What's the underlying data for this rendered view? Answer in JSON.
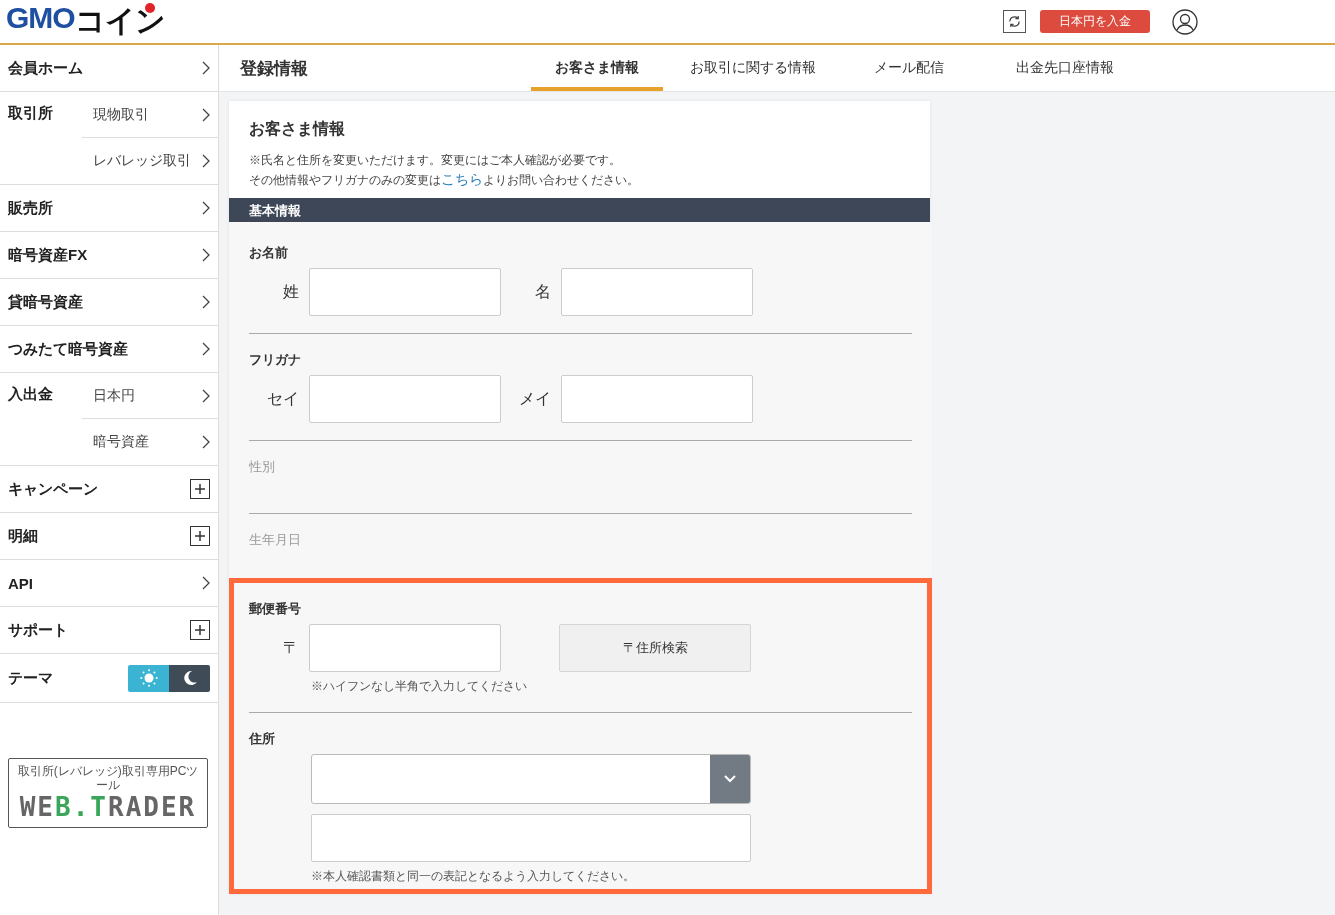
{
  "header": {
    "logo": {
      "primary": "GMO",
      "secondary": "コイン"
    },
    "deposit_button": "日本円を入金"
  },
  "sidebar": {
    "items": [
      {
        "kind": "link",
        "label": "会員ホーム"
      },
      {
        "kind": "group",
        "label": "取引所",
        "children": [
          {
            "label": "現物取引"
          },
          {
            "label": "レバレッジ取引"
          }
        ]
      },
      {
        "kind": "link",
        "label": "販売所"
      },
      {
        "kind": "link",
        "label": "暗号資産FX"
      },
      {
        "kind": "link",
        "label": "貸暗号資産"
      },
      {
        "kind": "link",
        "label": "つみたて暗号資産"
      },
      {
        "kind": "group",
        "label": "入出金",
        "children": [
          {
            "label": "日本円"
          },
          {
            "label": "暗号資産"
          }
        ]
      },
      {
        "kind": "expand",
        "label": "キャンペーン"
      },
      {
        "kind": "expand",
        "label": "明細"
      },
      {
        "kind": "link",
        "label": "API"
      },
      {
        "kind": "expand",
        "label": "サポート"
      },
      {
        "kind": "theme",
        "label": "テーマ",
        "options": [
          {
            "kind": "light",
            "selected": true
          },
          {
            "kind": "dark",
            "selected": false
          }
        ]
      }
    ],
    "banner": {
      "caption": "取引所(レバレッジ)取引専用PCツール",
      "logo_parts": [
        {
          "text": "WE",
          "accent": false
        },
        {
          "text": "B.T",
          "accent": true
        },
        {
          "text": "RADER",
          "accent": false
        }
      ]
    }
  },
  "page": {
    "title": "登録情報",
    "tabs": [
      {
        "label": "お客さま情報",
        "selected": true
      },
      {
        "label": "お取引に関する情報",
        "selected": false
      },
      {
        "label": "メール配信",
        "selected": false
      },
      {
        "label": "出金先口座情報",
        "selected": false
      }
    ]
  },
  "card": {
    "title": "お客さま情報",
    "notes": [
      "※氏名と住所を変更いただけます。変更にはご本人確認が必要です。",
      {
        "before": "その他情報やフリガナのみの変更は",
        "link": "こちら",
        "after": "よりお問い合わせください。"
      }
    ],
    "section_title": "基本情報",
    "groups": [
      {
        "highlighted": false,
        "fields": [
          {
            "kind": "pair",
            "label": "お名前",
            "parts": [
              {
                "label": "姓"
              },
              {
                "label": "名"
              }
            ]
          },
          {
            "kind": "pair",
            "label": "フリガナ",
            "parts": [
              {
                "label": "セイ"
              },
              {
                "label": "メイ"
              }
            ]
          },
          {
            "kind": "readonly",
            "label": "性別"
          },
          {
            "kind": "readonly",
            "label": "生年月日"
          }
        ]
      },
      {
        "highlighted": true,
        "fields": [
          {
            "kind": "postal",
            "label": "郵便番号",
            "prefix": "〒",
            "button": "〒住所検索",
            "hint": "※ハイフンなし半角で入力してください"
          },
          {
            "kind": "address",
            "label": "住所",
            "hint": "※本人確認書類と同一の表記となるよう入力してください。"
          }
        ]
      }
    ]
  }
}
